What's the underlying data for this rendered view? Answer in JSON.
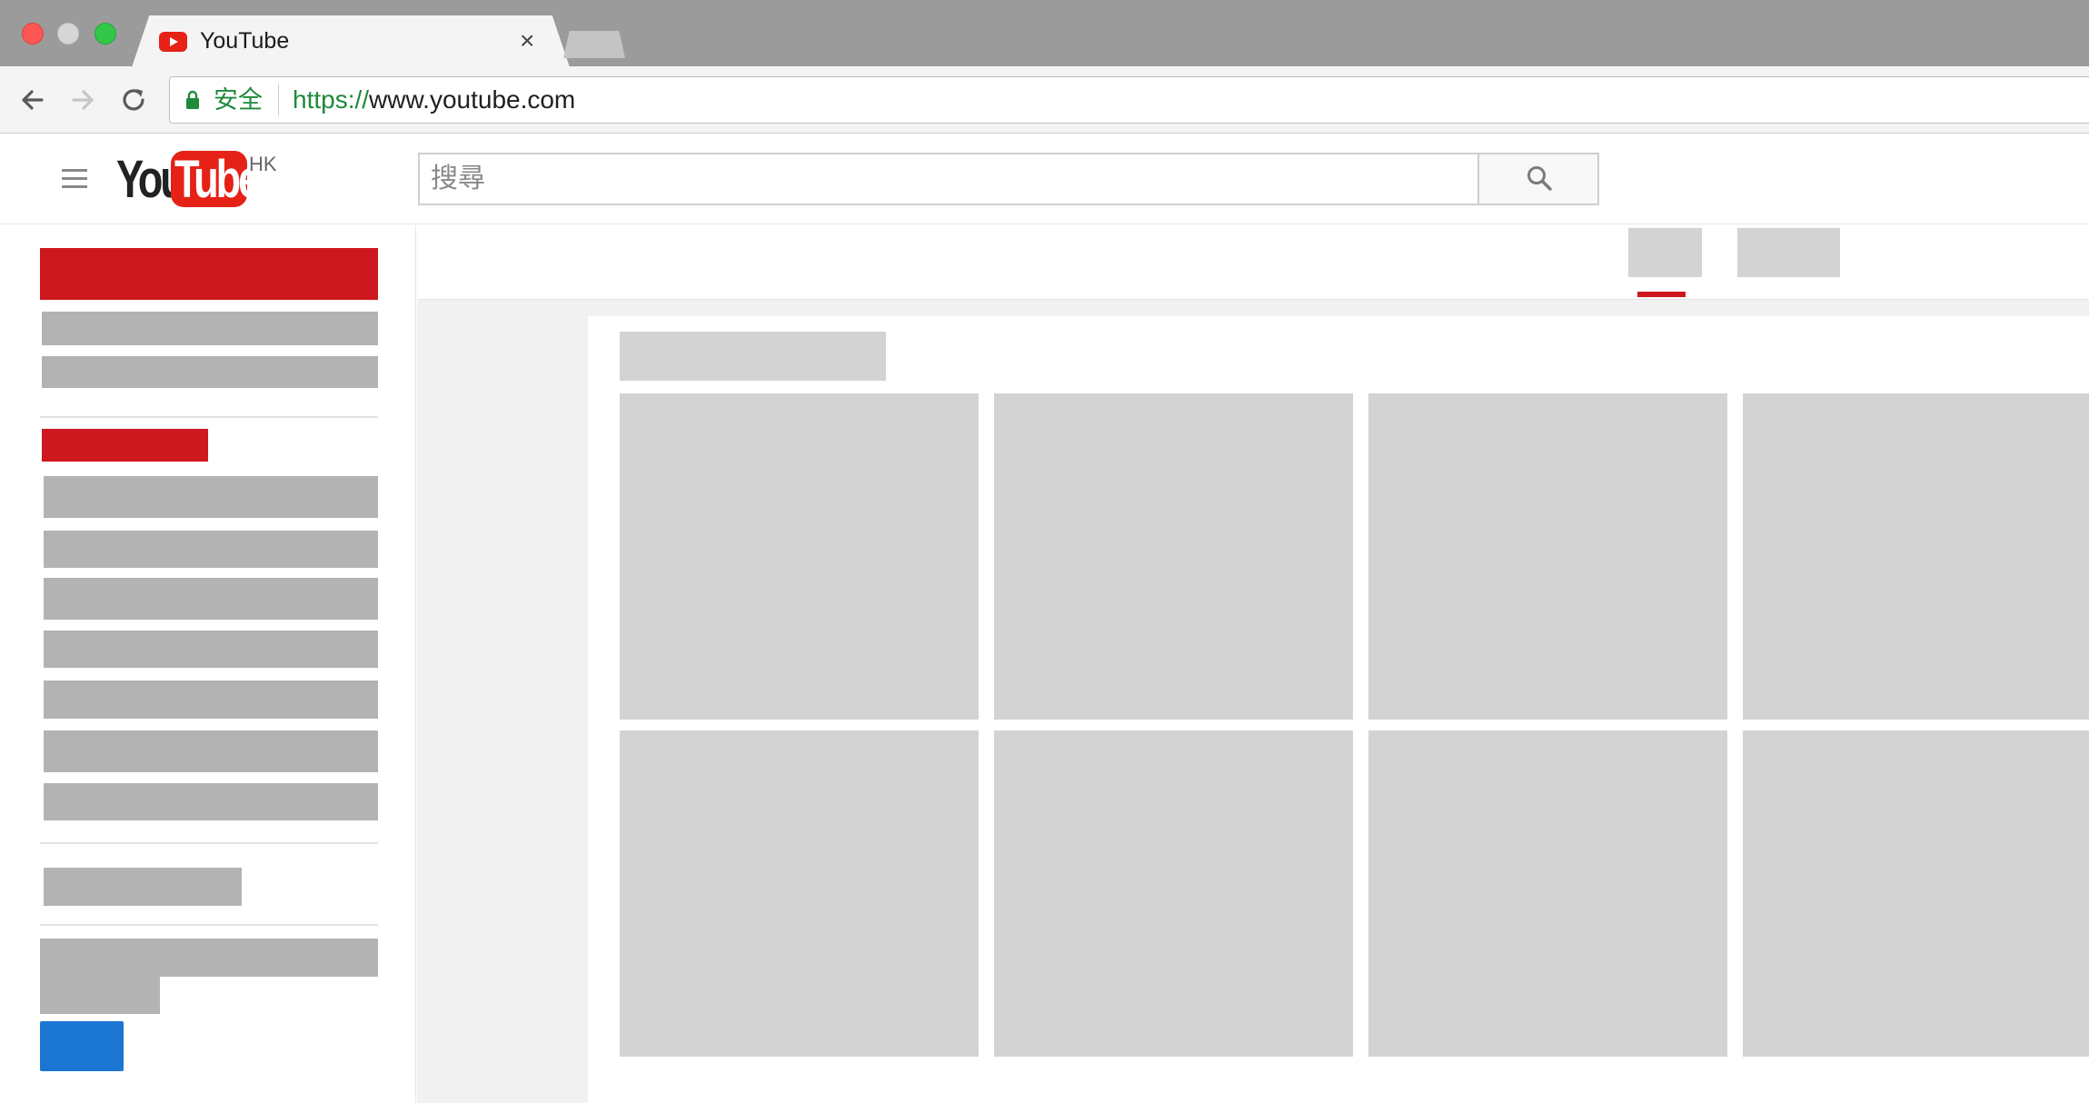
{
  "browser": {
    "tab_title": "YouTube",
    "tab_close_glyph": "×",
    "secure_label": "安全",
    "url_scheme": "https://",
    "url_host": "www.youtube.com",
    "icons": [
      "back-arrow-icon",
      "forward-arrow-icon",
      "reload-icon",
      "lock-icon",
      "youtube-favicon-icon",
      "close-icon"
    ]
  },
  "masthead": {
    "logo_you": "You",
    "logo_tube": "Tube",
    "region": "HK",
    "search_placeholder": "搜尋",
    "icons": [
      "hamburger-menu-icon",
      "search-icon"
    ]
  },
  "colors": {
    "youtube_red": "#cc181e",
    "logo_red": "#e62117",
    "skeleton_dark": "#b3b3b3",
    "skeleton_light": "#d3d3d3",
    "accent_blue": "#1b76d1",
    "secure_green": "#1f8a3b",
    "content_background": "#f1f1f1"
  }
}
